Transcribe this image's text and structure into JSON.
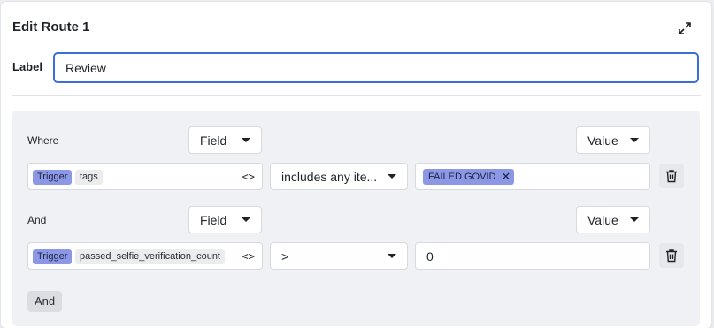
{
  "dialog": {
    "title": "Edit Route 1",
    "label_text": "Label",
    "label_value": "Review"
  },
  "conditions": [
    {
      "row_label": "Where",
      "field_dropdown": "Field",
      "value_dropdown": "Value",
      "field_chips": [
        "Trigger",
        "tags"
      ],
      "operator": "includes any ite...",
      "value_chip": "FAILED GOVID"
    },
    {
      "row_label": "And",
      "field_dropdown": "Field",
      "value_dropdown": "Value",
      "field_chips": [
        "Trigger",
        "passed_selfie_verification_count"
      ],
      "operator": ">",
      "value": "0"
    }
  ],
  "add_and_label": "And",
  "icons": {
    "expand": "expand-icon",
    "code": "code-icon",
    "trash": "trash-icon",
    "remove": "close-icon"
  },
  "colors": {
    "accent": "#3b6fd8",
    "chip": "#8c98e6"
  }
}
